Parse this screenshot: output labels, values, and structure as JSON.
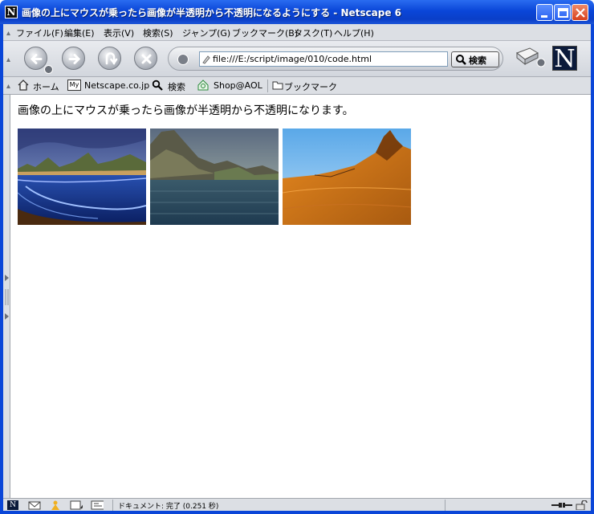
{
  "window": {
    "title": "画像の上にマウスが乗ったら画像が半透明から不透明になるようにする - Netscape 6",
    "app_icon_letter": "N"
  },
  "menu": [
    "ファイル(F)",
    "編集(E)",
    "表示(V)",
    "検索(S)",
    "ジャンプ(G)",
    "ブックマーク(B)",
    "タスク(T)",
    "ヘルプ(H)"
  ],
  "navigation": {
    "url": "file:///E:/script/image/010/code.html",
    "search_label": "検索",
    "logo_letter": "N"
  },
  "personal_toolbar": {
    "home": "ホーム",
    "netscape_badge": "My",
    "netscape": "Netscape.co.jp",
    "search": "検索",
    "shop": "Shop@AOL",
    "bookmarks": "ブックマーク"
  },
  "content": {
    "text": "画像の上にマウスが乗ったら画像が半透明から不透明になります。",
    "images": [
      "coastal-landscape-image",
      "ocean-mountains-image",
      "desert-dune-image"
    ]
  },
  "status": {
    "text": "ドキュメント: 完了 (0.251 秒)"
  },
  "colors": {
    "titlebar": "#0a46d8",
    "chrome": "#dcdfe4"
  }
}
